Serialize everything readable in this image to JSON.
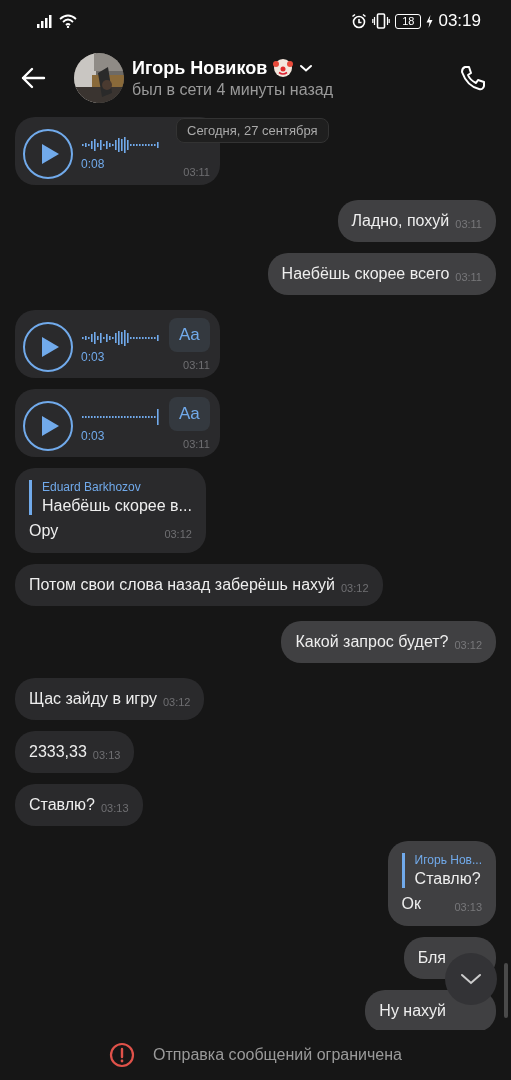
{
  "status_bar": {
    "battery": "18",
    "time": "03:19"
  },
  "header": {
    "name": "Игорь Новиков",
    "status": "был в сети 4 минуты назад"
  },
  "date_pill": "Сегодня, 27 сентября",
  "messages": [
    {
      "kind": "voice",
      "outgoing": false,
      "duration": "0:08",
      "time": "03:11"
    },
    {
      "kind": "text",
      "outgoing": true,
      "text": "Ладно, похуй",
      "time": "03:11"
    },
    {
      "kind": "text",
      "outgoing": true,
      "text": "Наебёшь скорее всего",
      "time": "03:11"
    },
    {
      "kind": "voice",
      "outgoing": false,
      "duration": "0:03",
      "transcribe": "Aa",
      "time": "03:11"
    },
    {
      "kind": "voice",
      "outgoing": false,
      "duration": "0:03",
      "transcribe": "Aa",
      "time": "03:11"
    },
    {
      "kind": "reply",
      "outgoing": false,
      "quote_author": "Eduard Barkhozov",
      "quote_text": "Наебёшь скорее в...",
      "text": "Ору",
      "time": "03:12"
    },
    {
      "kind": "text",
      "outgoing": false,
      "text": "Потом свои слова назад заберёшь нахуй",
      "time": "03:12"
    },
    {
      "kind": "text",
      "outgoing": true,
      "text": "Какой запрос будет?",
      "time": "03:12"
    },
    {
      "kind": "text",
      "outgoing": false,
      "text": "Щас зайду в игру",
      "time": "03:12"
    },
    {
      "kind": "text",
      "outgoing": false,
      "text": "2333,33",
      "time": "03:13"
    },
    {
      "kind": "text",
      "outgoing": false,
      "text": "Ставлю?",
      "time": "03:13"
    },
    {
      "kind": "reply",
      "outgoing": true,
      "quote_author": "Игорь Нов...",
      "quote_text": "Ставлю?",
      "text": "Ок",
      "time": "03:13"
    },
    {
      "kind": "text",
      "outgoing": true,
      "text": "Бля"
    },
    {
      "kind": "text",
      "outgoing": true,
      "text": "Ну нахуй"
    }
  ],
  "footer": {
    "notice": "Отправка сообщений ограничена"
  }
}
